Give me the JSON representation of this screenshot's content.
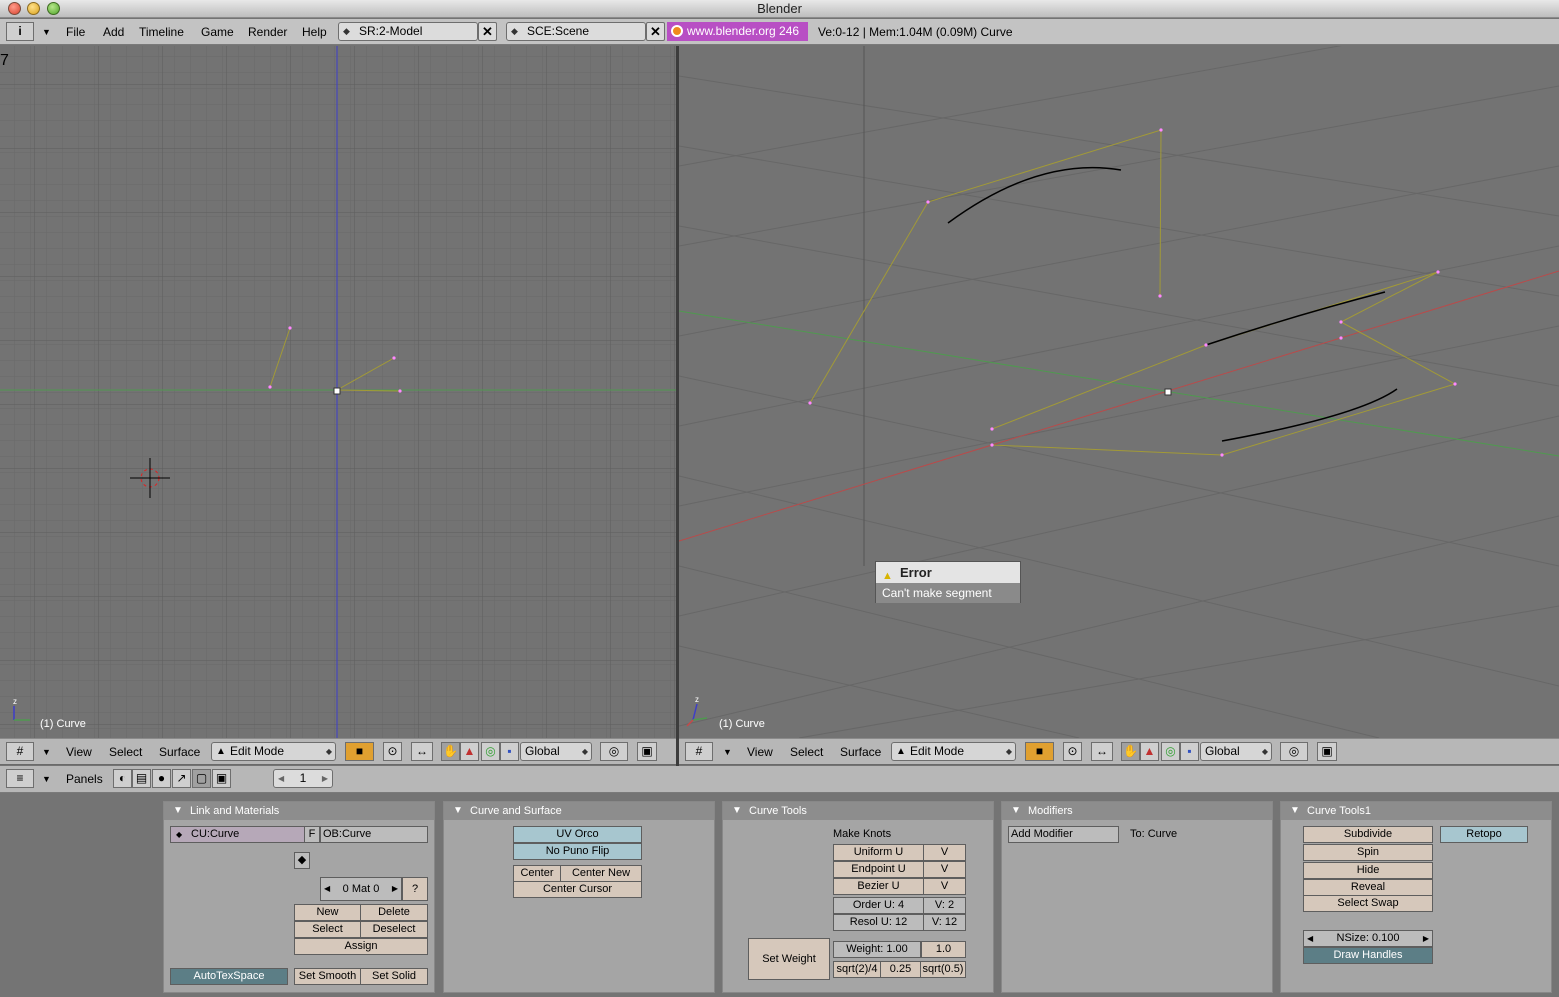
{
  "window": {
    "title": "Blender"
  },
  "topbar": {
    "menus": [
      "File",
      "Add",
      "Timeline",
      "Game",
      "Render",
      "Help"
    ],
    "screen_field": "SR:2-Model",
    "scene_field": "SCE:Scene",
    "blender_link": "www.blender.org 246",
    "stats": "Ve:0-12 | Mem:1.04M (0.09M) Curve"
  },
  "viewports": {
    "left_label": "(1) Curve",
    "right_label": "(1) Curve",
    "left_corner": "7"
  },
  "view_header": {
    "menus": [
      "View",
      "Select",
      "Surface"
    ],
    "mode": "Edit Mode",
    "orientation": "Global"
  },
  "buttons_header": {
    "panels_label": "Panels",
    "frame": "1"
  },
  "error_popup": {
    "title": "Error",
    "message": "Can't make segment"
  },
  "panels": {
    "link_materials": {
      "title": "Link and Materials",
      "cu_field": "CU:Curve",
      "f_button": "F",
      "ob_field": "OB:Curve",
      "mat": "0 Mat 0",
      "question": "?",
      "new": "New",
      "delete": "Delete",
      "select": "Select",
      "deselect": "Deselect",
      "assign": "Assign",
      "autotex": "AutoTexSpace",
      "set_smooth": "Set Smooth",
      "set_solid": "Set Solid"
    },
    "curve_surface": {
      "title": "Curve and Surface",
      "uv_orco": "UV Orco",
      "no_puno": "No Puno Flip",
      "center": "Center",
      "center_new": "Center New",
      "center_cursor": "Center Cursor"
    },
    "curve_tools": {
      "title": "Curve Tools",
      "make_knots": "Make Knots",
      "uniform_u": "Uniform U",
      "endpoint_u": "Endpoint U",
      "bezier_u": "Bezier U",
      "v": "V",
      "order_u": "Order U: 4",
      "order_v": "V: 2",
      "resol_u": "Resol U: 12",
      "resol_v": "V: 12",
      "set_weight": "Set Weight",
      "weight": "Weight: 1.00",
      "w_1": "1.0",
      "w_sqrt24": "sqrt(2)/4",
      "w_025": "0.25",
      "w_sqrt05": "sqrt(0.5)"
    },
    "modifiers": {
      "title": "Modifiers",
      "add_modifier": "Add Modifier",
      "to": "To: Curve"
    },
    "curve_tools1": {
      "title": "Curve Tools1",
      "subdivide": "Subdivide",
      "retopo": "Retopo",
      "spin": "Spin",
      "hide": "Hide",
      "reveal": "Reveal",
      "select_swap": "Select Swap",
      "nsize": "NSize: 0.100",
      "draw_handles": "Draw Handles"
    }
  }
}
